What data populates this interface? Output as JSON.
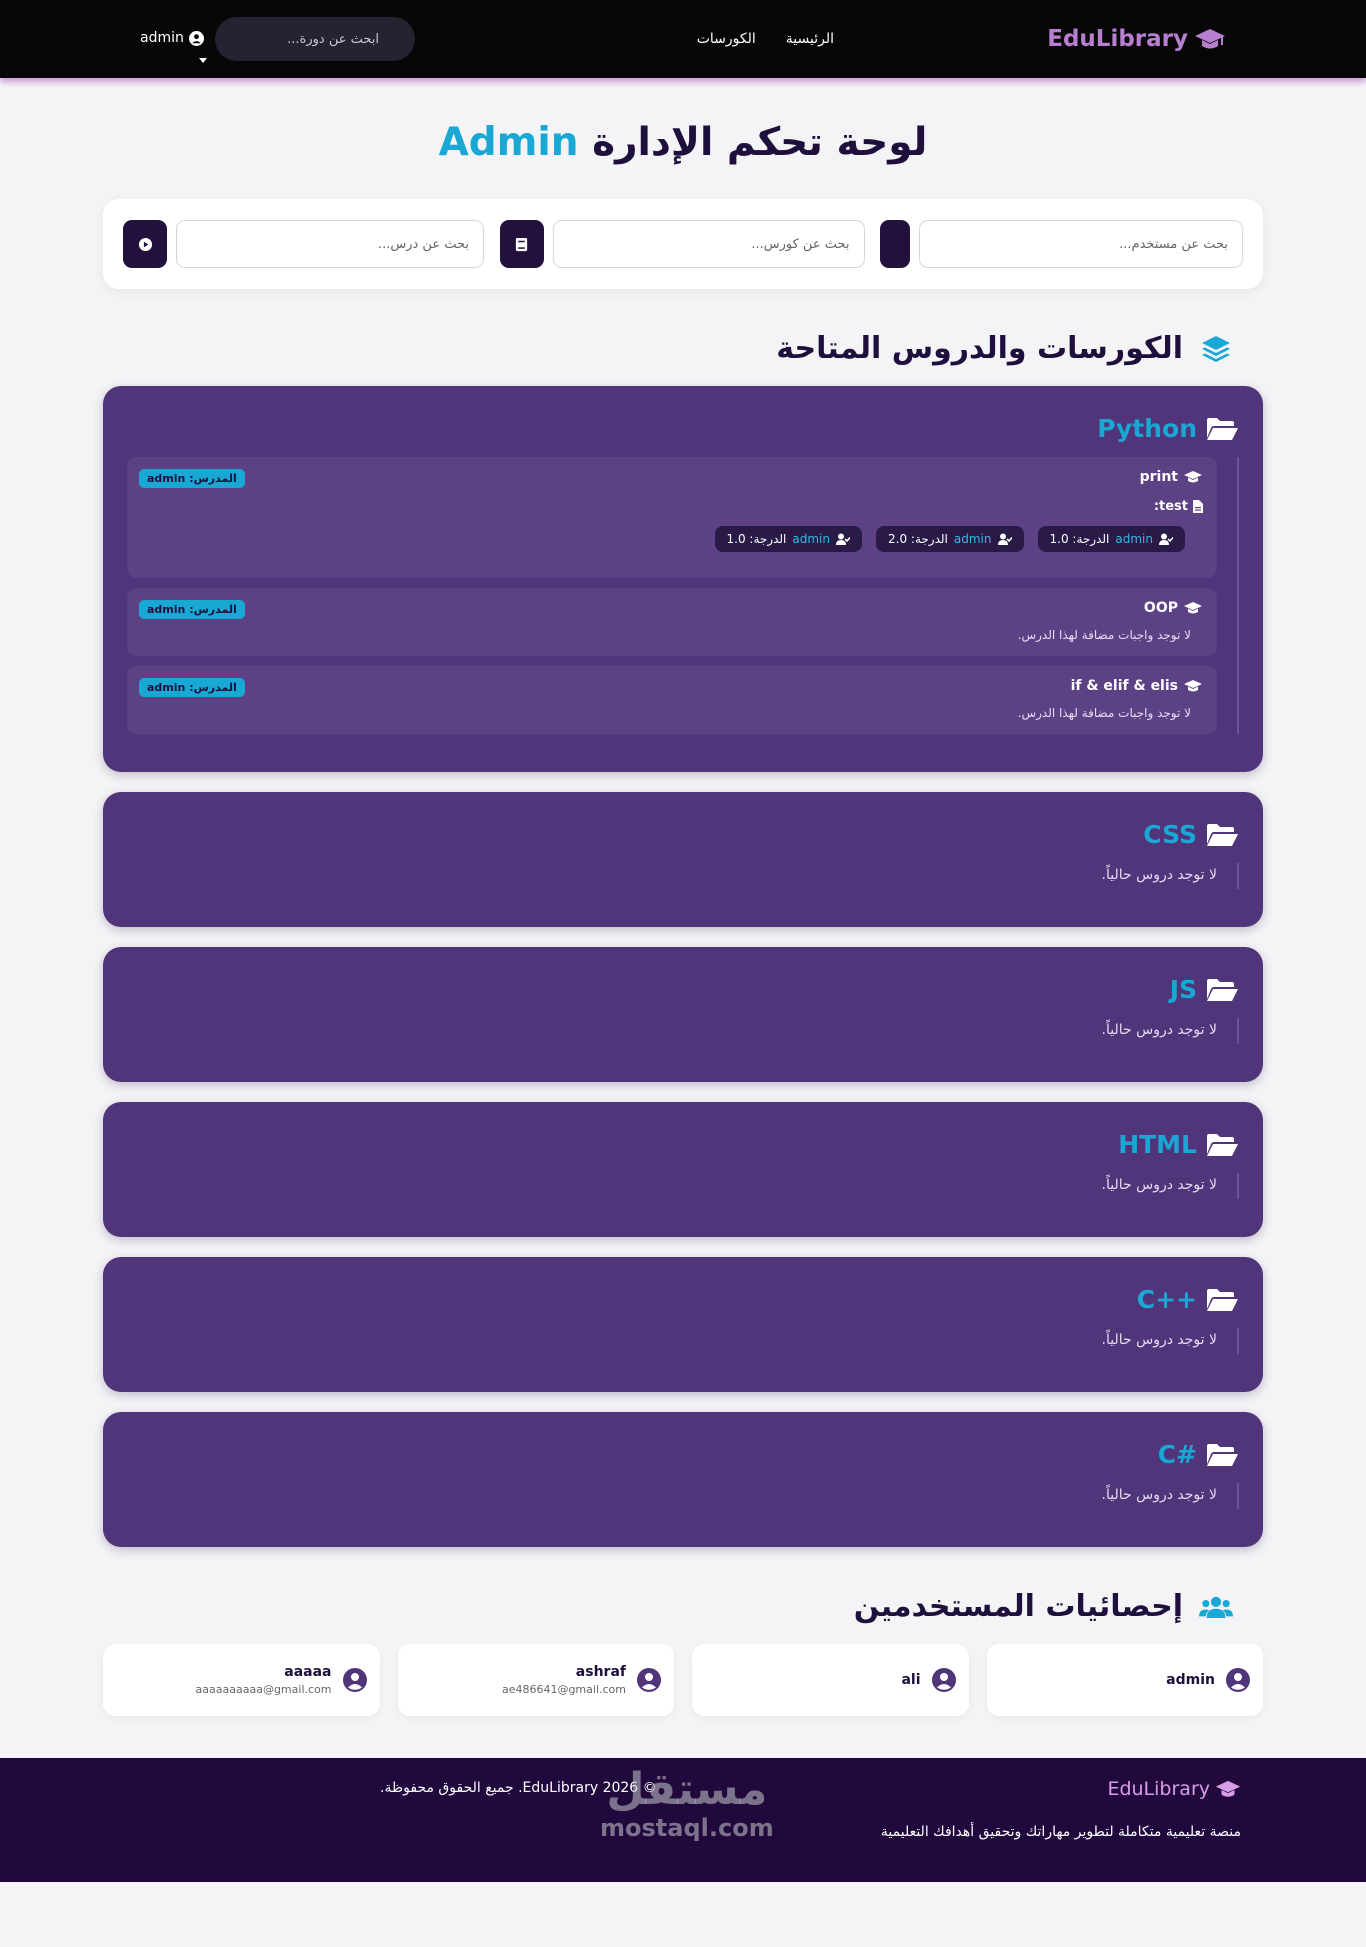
{
  "nav": {
    "brand": "EduLibrary",
    "links": [
      "الرئيسية",
      "الكورسات"
    ],
    "search_placeholder": "ابحث عن دورة...",
    "user": "admin"
  },
  "page": {
    "title_main": "لوحة تحكم الإدارة",
    "title_accent": "Admin"
  },
  "search": {
    "user_placeholder": "بحث عن مستخدم...",
    "course_placeholder": "بحث عن كورس...",
    "lesson_placeholder": "بحث عن درس..."
  },
  "courses_section": {
    "title": "الكورسات والدروس المتاحة",
    "teacher_label": "المدرس: admin",
    "no_homework": "لا توجد واجبات مضافة لهذا الدرس.",
    "no_lessons": "لا توجد دروس حالياً."
  },
  "courses": [
    {
      "name": "Python",
      "lessons": [
        {
          "name": "print",
          "assignment": "test:",
          "grades": [
            {
              "user": "admin",
              "grade": "الدرجة: 1.0"
            },
            {
              "user": "admin",
              "grade": "الدرجة: 2.0"
            },
            {
              "user": "admin",
              "grade": "الدرجة: 1.0"
            }
          ]
        },
        {
          "name": "OOP"
        },
        {
          "name": "if & elif & elis"
        }
      ]
    },
    {
      "name": "CSS"
    },
    {
      "name": "JS"
    },
    {
      "name": "HTML"
    },
    {
      "name": "C++"
    },
    {
      "name": "C#"
    }
  ],
  "users_section": {
    "title": "إحصائيات المستخدمين",
    "users": [
      {
        "name": "admin",
        "email": ""
      },
      {
        "name": "ali",
        "email": ""
      },
      {
        "name": "ashraf",
        "email": "ae486641@gmail.com"
      },
      {
        "name": "aaaaa",
        "email": "aaaaaaaaaa@gmail.com"
      }
    ]
  },
  "footer": {
    "brand": "EduLibrary",
    "description": "منصة تعليمية متكاملة لتطوير مهاراتك وتحقيق أهدافك التعليمية",
    "copyright": "© 2026 EduLibrary. جميع الحقوق محفوظة.",
    "watermark_arabic": "مستقل",
    "watermark_latin": "mostaql.com"
  },
  "colors": {
    "accent": "#19a8d4",
    "brand": "#b87fd0",
    "card_bg": "#50357a",
    "dark": "#22103d"
  },
  "icons": {
    "brand": "graduation-cap-icon",
    "search": "search-icon",
    "user": "user-circle-icon",
    "section_courses": "layer-group-icon",
    "course": "folder-open-icon",
    "lesson": "graduation-cap-icon",
    "assignment": "file-icon",
    "grade": "user-check-icon",
    "section_users": "users-icon",
    "search_course": "book-icon",
    "search_lesson": "play-circle-icon"
  }
}
